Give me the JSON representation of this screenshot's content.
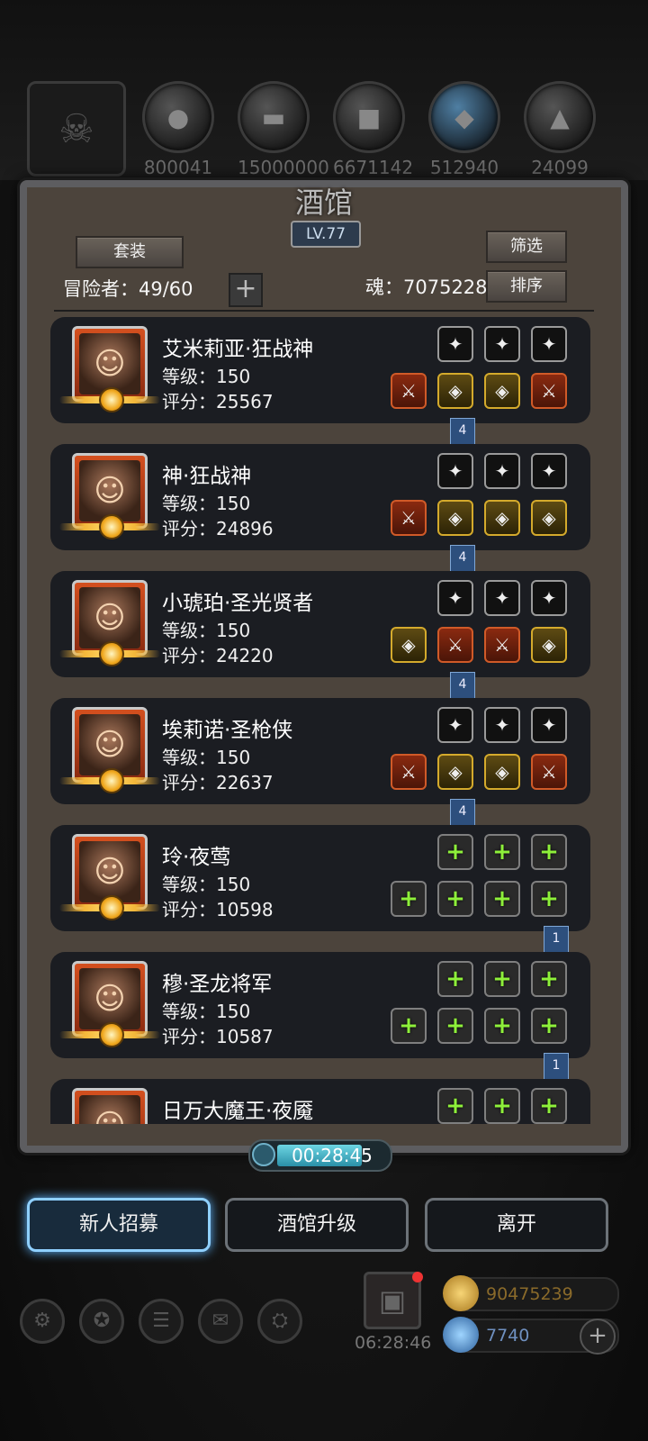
{
  "resources": [
    {
      "icon": "helmet-icon",
      "value": ""
    },
    {
      "icon": "meat-icon",
      "value": "800041"
    },
    {
      "icon": "wood-icon",
      "value": "15000000"
    },
    {
      "icon": "stone-icon",
      "value": "6671142"
    },
    {
      "icon": "crystal-icon",
      "value": "512940"
    },
    {
      "icon": "iron-icon",
      "value": "24099"
    }
  ],
  "panel": {
    "title": "酒馆",
    "level": "LV.77",
    "set_button": "套装",
    "filter_button": "筛选",
    "sort_button": "排序",
    "adventurers_label": "冒险者：49/60",
    "soul_label": "魂：7075228"
  },
  "heroes": [
    {
      "name": "艾米莉亚·狂战神",
      "level": "等级：150",
      "score": "评分：25567",
      "tag": "4",
      "top_slots": [
        "dark",
        "dark",
        "dark"
      ],
      "bottom_slots": [
        "red",
        "gold",
        "gold",
        "red"
      ]
    },
    {
      "name": "神·狂战神",
      "level": "等级：150",
      "score": "评分：24896",
      "tag": "4",
      "top_slots": [
        "dark",
        "dark",
        "dark"
      ],
      "bottom_slots": [
        "red",
        "gold",
        "gold",
        "gold"
      ]
    },
    {
      "name": "小琥珀·圣光贤者",
      "level": "等级：150",
      "score": "评分：24220",
      "tag": "4",
      "top_slots": [
        "dark",
        "dark",
        "dark"
      ],
      "bottom_slots": [
        "gold",
        "red",
        "red",
        "gold"
      ]
    },
    {
      "name": "埃莉诺·圣枪侠",
      "level": "等级：150",
      "score": "评分：22637",
      "tag": "4",
      "top_slots": [
        "dark",
        "dark",
        "dark"
      ],
      "bottom_slots": [
        "red",
        "gold",
        "gold",
        "red"
      ]
    },
    {
      "name": "玲·夜莺",
      "level": "等级：150",
      "score": "评分：10598",
      "tag": "1",
      "top_slots": [
        "empty",
        "empty",
        "empty"
      ],
      "bottom_slots": [
        "empty",
        "empty",
        "empty",
        "empty"
      ]
    },
    {
      "name": "穆·圣龙将军",
      "level": "等级：150",
      "score": "评分：10587",
      "tag": "1",
      "top_slots": [
        "empty",
        "empty",
        "empty"
      ],
      "bottom_slots": [
        "empty",
        "empty",
        "empty",
        "empty"
      ]
    },
    {
      "name": "日万大魔王·夜魇",
      "level": "",
      "score": "",
      "tag": "",
      "top_slots": [
        "empty",
        "empty",
        "empty"
      ],
      "bottom_slots": []
    }
  ],
  "timer": "00:28:45",
  "buttons": {
    "recruit": "新人招募",
    "upgrade": "酒馆升级",
    "leave": "离开"
  },
  "bottom": {
    "gift_time": "06:28:46",
    "gold": "90475239",
    "gems": "7740"
  },
  "colors": {
    "accent_blue": "#8fd0ff",
    "gold_text": "#8a6a2a",
    "gem_text": "#6f90c0",
    "plus_green": "#8ef03a"
  }
}
